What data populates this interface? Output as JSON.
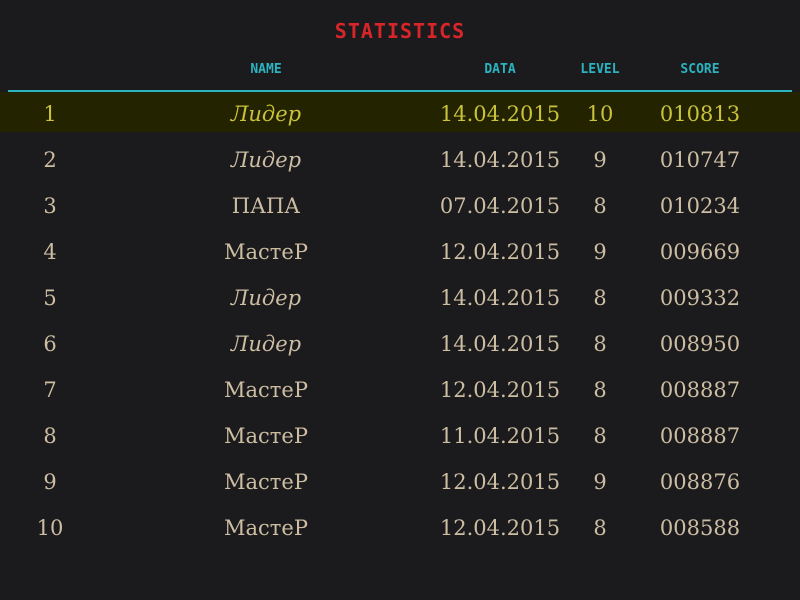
{
  "title": "STATISTICS",
  "colors": {
    "background": "#1b1b1d",
    "title": "#d8252a",
    "header": "#2bb3c0",
    "row_text": "#cdbda3",
    "highlight_text": "#c9c23a",
    "highlight_bg": "#232300"
  },
  "columns": {
    "name": "NAME",
    "data": "DATA",
    "level": "LEVEL",
    "score": "SCORE"
  },
  "rows": [
    {
      "rank": "1",
      "name": "Лидер",
      "date": "14.04.2015",
      "level": "10",
      "score": "010813",
      "italic": true,
      "highlight": true
    },
    {
      "rank": "2",
      "name": "Лидер",
      "date": "14.04.2015",
      "level": "9",
      "score": "010747",
      "italic": true,
      "highlight": false
    },
    {
      "rank": "3",
      "name": "ПАПА",
      "date": "07.04.2015",
      "level": "8",
      "score": "010234",
      "italic": false,
      "highlight": false
    },
    {
      "rank": "4",
      "name": "МастеР",
      "date": "12.04.2015",
      "level": "9",
      "score": "009669",
      "italic": false,
      "highlight": false
    },
    {
      "rank": "5",
      "name": "Лидер",
      "date": "14.04.2015",
      "level": "8",
      "score": "009332",
      "italic": true,
      "highlight": false
    },
    {
      "rank": "6",
      "name": "Лидер",
      "date": "14.04.2015",
      "level": "8",
      "score": "008950",
      "italic": true,
      "highlight": false
    },
    {
      "rank": "7",
      "name": "МастеР",
      "date": "12.04.2015",
      "level": "8",
      "score": "008887",
      "italic": false,
      "highlight": false
    },
    {
      "rank": "8",
      "name": "МастеР",
      "date": "11.04.2015",
      "level": "8",
      "score": "008887",
      "italic": false,
      "highlight": false
    },
    {
      "rank": "9",
      "name": "МастеР",
      "date": "12.04.2015",
      "level": "9",
      "score": "008876",
      "italic": false,
      "highlight": false
    },
    {
      "rank": "10",
      "name": "МастеР",
      "date": "12.04.2015",
      "level": "8",
      "score": "008588",
      "italic": false,
      "highlight": false
    }
  ]
}
